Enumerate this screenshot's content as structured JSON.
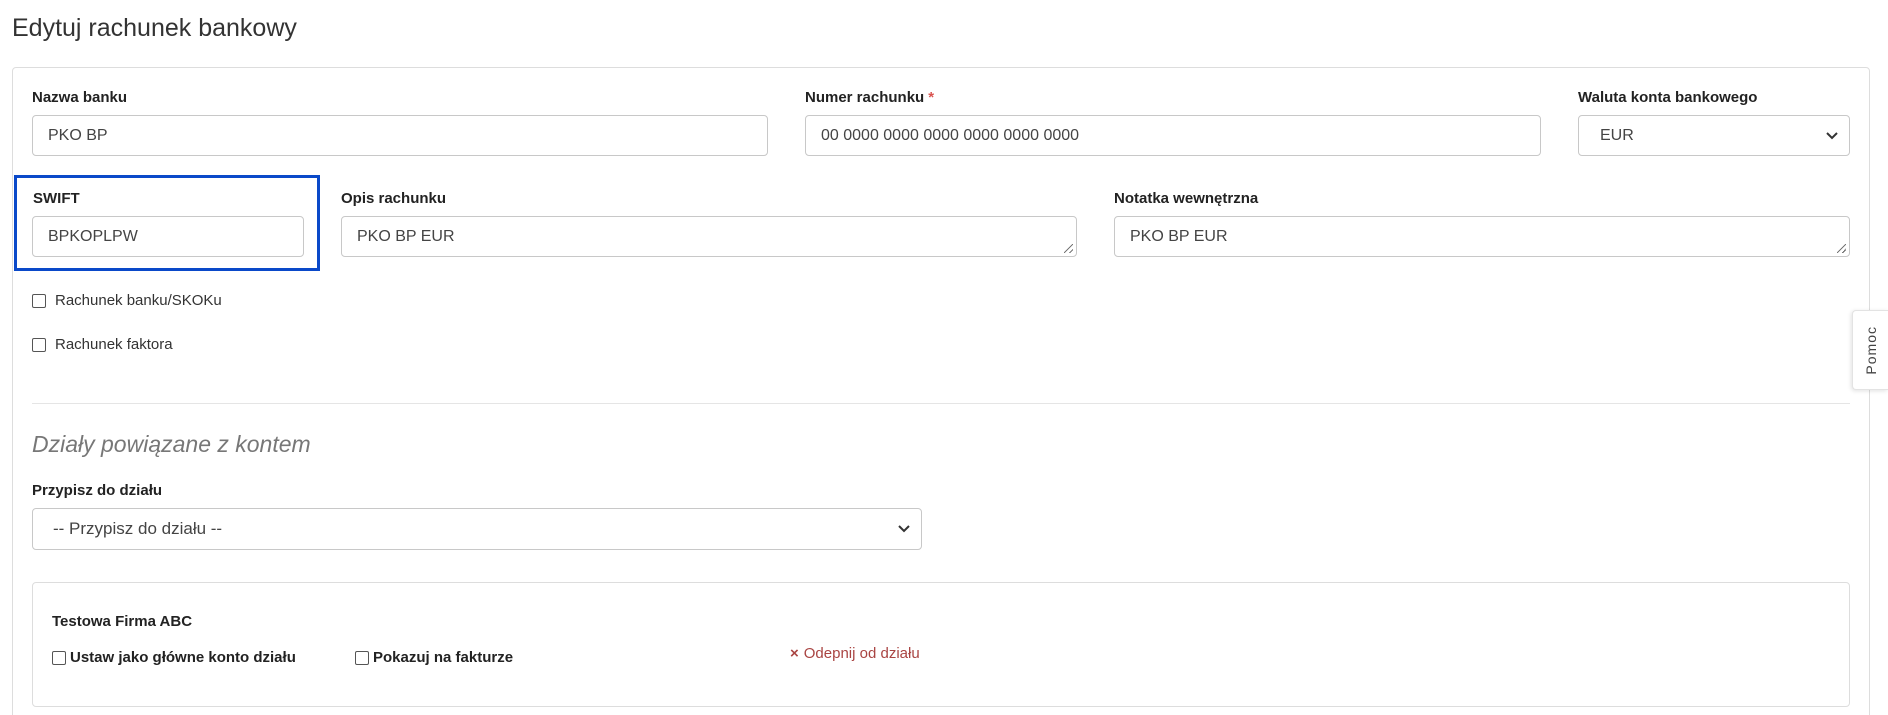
{
  "page": {
    "title": "Edytuj rachunek bankowy"
  },
  "form": {
    "bank_name": {
      "label": "Nazwa banku",
      "value": "PKO BP"
    },
    "account_number": {
      "label": "Numer rachunku",
      "required_mark": "*",
      "value": "00 0000 0000 0000 0000 0000 0000"
    },
    "currency": {
      "label": "Waluta konta bankowego",
      "selected": "EUR"
    },
    "swift": {
      "label": "SWIFT",
      "value": "BPKOPLPW"
    },
    "description": {
      "label": "Opis rachunku",
      "value": "PKO BP EUR"
    },
    "internal_note": {
      "label": "Notatka wewnętrzna",
      "value": "PKO BP EUR"
    },
    "checkboxes": {
      "bank_skok": {
        "label": "Rachunek banku/SKOKu",
        "checked": false
      },
      "factor": {
        "label": "Rachunek faktora",
        "checked": false
      }
    }
  },
  "departments": {
    "heading": "Działy powiązane z kontem",
    "assign_label": "Przypisz do działu",
    "assign_selected": "-- Przypisz do działu --",
    "items": [
      {
        "name": "Testowa Firma ABC",
        "main_account_label": "Ustaw jako główne konto działu",
        "main_account_checked": false,
        "show_on_invoice_label": "Pokazuj na fakturze",
        "show_on_invoice_checked": false,
        "unpin_label": "Odepnij od działu",
        "unpin_icon": "×"
      }
    ]
  },
  "help_tab": {
    "label": "Pomoc"
  },
  "colors": {
    "highlight": "#0a49c9",
    "danger": "#a94442",
    "required": "#d9534f"
  }
}
